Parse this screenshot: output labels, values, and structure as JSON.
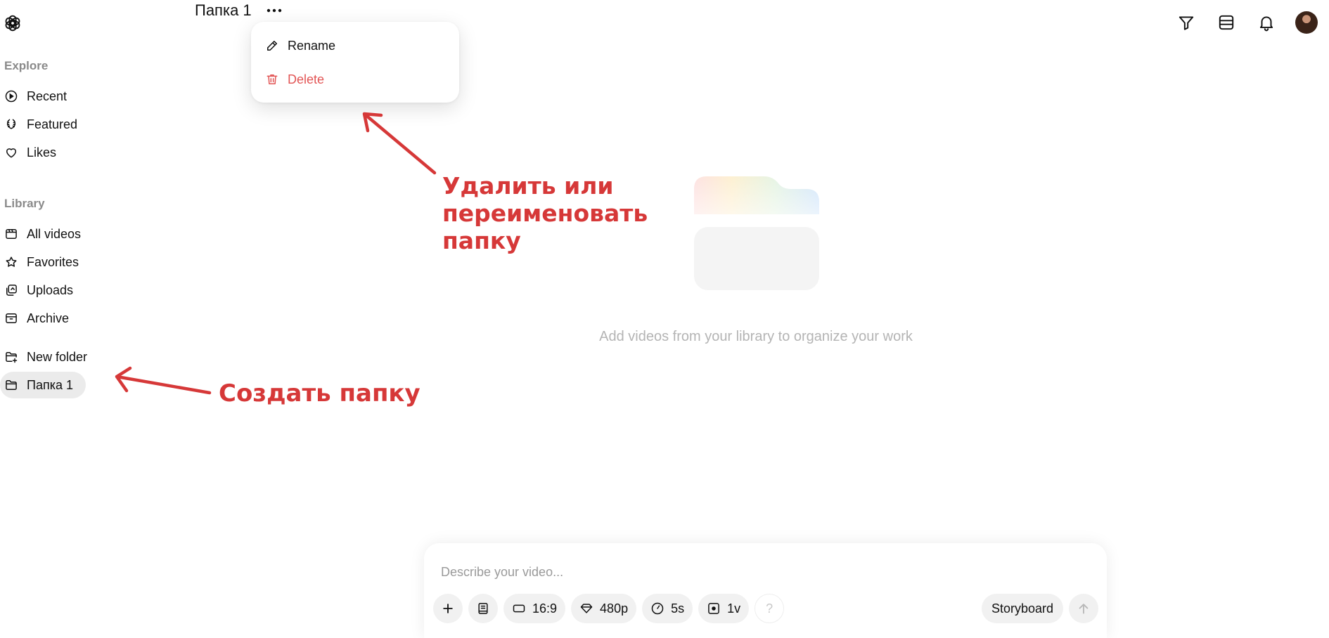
{
  "sidebar": {
    "logo_icon": "openai-logo-icon",
    "explore_label": "Explore",
    "explore_items": [
      {
        "label": "Recent",
        "icon": "play-circle-icon"
      },
      {
        "label": "Featured",
        "icon": "laurel-icon"
      },
      {
        "label": "Likes",
        "icon": "heart-icon"
      }
    ],
    "library_label": "Library",
    "library_items": [
      {
        "label": "All videos",
        "icon": "film-icon"
      },
      {
        "label": "Favorites",
        "icon": "star-icon"
      },
      {
        "label": "Uploads",
        "icon": "upload-icon"
      },
      {
        "label": "Archive",
        "icon": "archive-icon"
      }
    ],
    "new_folder_label": "New folder",
    "folders": [
      {
        "label": "Папка 1",
        "active": true
      }
    ]
  },
  "header": {
    "folder_title": "Папка 1",
    "more_icon": "more-horizontal-icon",
    "icons": [
      "filter-icon",
      "layout-icon",
      "bell-icon"
    ],
    "avatar": "avatar"
  },
  "folder_menu": {
    "items": [
      {
        "label": "Rename",
        "icon": "pencil-icon"
      },
      {
        "label": "Delete",
        "icon": "trash-icon"
      }
    ]
  },
  "empty_state": {
    "message": "Add videos from your library to organize your work"
  },
  "composer": {
    "placeholder": "Describe your video...",
    "aspect_ratio": "16:9",
    "resolution": "480p",
    "duration": "5s",
    "variations": "1v",
    "help": "?",
    "storyboard_label": "Storyboard"
  },
  "annotations": {
    "menu_note_lines": [
      "Удалить или",
      "переименовать",
      "папку"
    ],
    "create_note": "Создать папку"
  },
  "colors": {
    "annotation": "#d63838",
    "danger": "#e25555",
    "active_bg": "#ebebeb"
  }
}
